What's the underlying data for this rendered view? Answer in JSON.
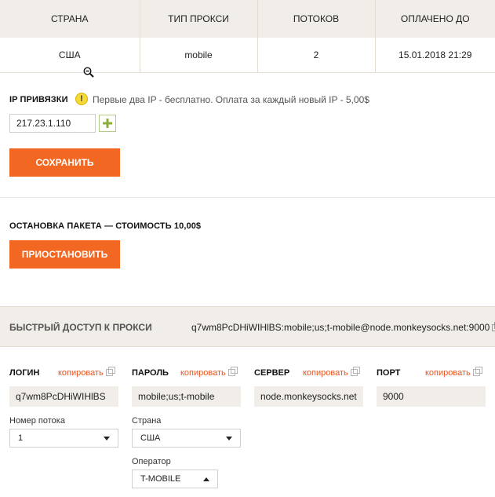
{
  "table": {
    "headers": [
      "СТРАНА",
      "ТИП ПРОКСИ",
      "ПОТОКОВ",
      "ОПЛАЧЕНО ДО"
    ],
    "row": [
      "США",
      "mobile",
      "2",
      "15.01.2018 21:29"
    ]
  },
  "ip_binding": {
    "label": "IP ПРИВЯЗКИ",
    "hint_icon_text": "!",
    "hint": "Первые два IP - бесплатно. Оплата за каждый новый IP - 5,00$",
    "ip_value": "217.23.1.110",
    "add_icon": "plus-icon",
    "save_label": "СОХРАНИТЬ"
  },
  "pause": {
    "label": "ОСТАНОВКА ПАКЕТА — СТОИМОСТЬ 10,00$",
    "button_label": "ПРИОСТАНОВИТЬ"
  },
  "quick_access": {
    "title": "БЫСТРЫЙ ДОСТУП К ПРОКСИ",
    "value": "q7wm8PcDHiWIHlBS:mobile;us;t-mobile@node.monkeysocks.net:9000"
  },
  "credentials": {
    "copy_label": "копировать",
    "login": {
      "label": "ЛОГИН",
      "value": "q7wm8PcDHiWIHlBS"
    },
    "password": {
      "label": "ПАРОЛЬ",
      "value": "mobile;us;t-mobile"
    },
    "server": {
      "label": "СЕРВЕР",
      "value": "node.monkeysocks.net"
    },
    "port": {
      "label": "ПОРТ",
      "value": "9000"
    }
  },
  "selects": {
    "stream": {
      "label": "Номер потока",
      "value": "1"
    },
    "country": {
      "label": "Страна",
      "value": "США"
    },
    "operator": {
      "label": "Оператор",
      "value": "T-MOBILE"
    }
  },
  "colors": {
    "accent": "#f26722",
    "link": "#e8541f",
    "panel": "#f1ede8"
  }
}
